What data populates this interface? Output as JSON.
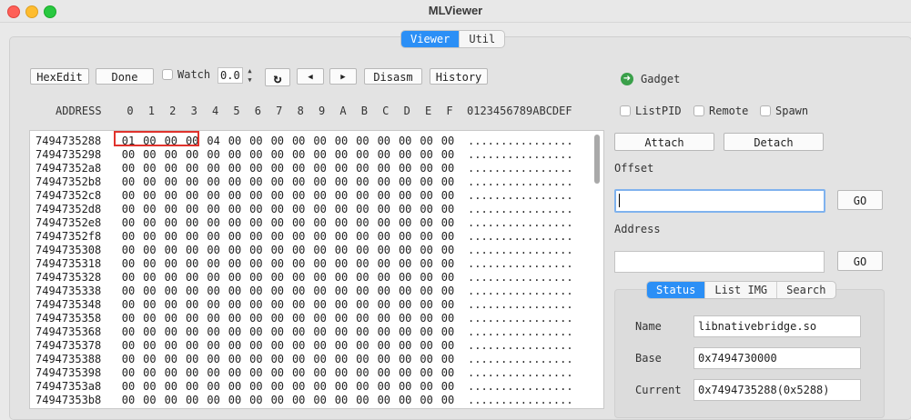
{
  "window": {
    "title": "MLViewer"
  },
  "tabs": [
    {
      "label": "Viewer",
      "selected": true
    },
    {
      "label": "Util",
      "selected": false
    }
  ],
  "toolbar": {
    "hexedit": "HexEdit",
    "done": "Done",
    "watch_label": "Watch",
    "watch_value": "0.0",
    "refresh_icon": "↻",
    "prev_icon": "◀",
    "next_icon": "▶",
    "disasm": "Disasm",
    "history": "History"
  },
  "hex": {
    "address_header": "ADDRESS",
    "columns": [
      "0",
      "1",
      "2",
      "3",
      "4",
      "5",
      "6",
      "7",
      "8",
      "9",
      "A",
      "B",
      "C",
      "D",
      "E",
      "F"
    ],
    "ascii_header": "0123456789ABCDEF",
    "rows": [
      {
        "addr": "7494735288",
        "bytes": [
          "01",
          "00",
          "00",
          "00",
          "04",
          "00",
          "00",
          "00",
          "00",
          "00",
          "00",
          "00",
          "00",
          "00",
          "00",
          "00"
        ],
        "ascii": "................"
      },
      {
        "addr": "7494735298",
        "bytes": [
          "00",
          "00",
          "00",
          "00",
          "00",
          "00",
          "00",
          "00",
          "00",
          "00",
          "00",
          "00",
          "00",
          "00",
          "00",
          "00"
        ],
        "ascii": "................"
      },
      {
        "addr": "74947352a8",
        "bytes": [
          "00",
          "00",
          "00",
          "00",
          "00",
          "00",
          "00",
          "00",
          "00",
          "00",
          "00",
          "00",
          "00",
          "00",
          "00",
          "00"
        ],
        "ascii": "................"
      },
      {
        "addr": "74947352b8",
        "bytes": [
          "00",
          "00",
          "00",
          "00",
          "00",
          "00",
          "00",
          "00",
          "00",
          "00",
          "00",
          "00",
          "00",
          "00",
          "00",
          "00"
        ],
        "ascii": "................"
      },
      {
        "addr": "74947352c8",
        "bytes": [
          "00",
          "00",
          "00",
          "00",
          "00",
          "00",
          "00",
          "00",
          "00",
          "00",
          "00",
          "00",
          "00",
          "00",
          "00",
          "00"
        ],
        "ascii": "................"
      },
      {
        "addr": "74947352d8",
        "bytes": [
          "00",
          "00",
          "00",
          "00",
          "00",
          "00",
          "00",
          "00",
          "00",
          "00",
          "00",
          "00",
          "00",
          "00",
          "00",
          "00"
        ],
        "ascii": "................"
      },
      {
        "addr": "74947352e8",
        "bytes": [
          "00",
          "00",
          "00",
          "00",
          "00",
          "00",
          "00",
          "00",
          "00",
          "00",
          "00",
          "00",
          "00",
          "00",
          "00",
          "00"
        ],
        "ascii": "................"
      },
      {
        "addr": "74947352f8",
        "bytes": [
          "00",
          "00",
          "00",
          "00",
          "00",
          "00",
          "00",
          "00",
          "00",
          "00",
          "00",
          "00",
          "00",
          "00",
          "00",
          "00"
        ],
        "ascii": "................"
      },
      {
        "addr": "7494735308",
        "bytes": [
          "00",
          "00",
          "00",
          "00",
          "00",
          "00",
          "00",
          "00",
          "00",
          "00",
          "00",
          "00",
          "00",
          "00",
          "00",
          "00"
        ],
        "ascii": "................"
      },
      {
        "addr": "7494735318",
        "bytes": [
          "00",
          "00",
          "00",
          "00",
          "00",
          "00",
          "00",
          "00",
          "00",
          "00",
          "00",
          "00",
          "00",
          "00",
          "00",
          "00"
        ],
        "ascii": "................"
      },
      {
        "addr": "7494735328",
        "bytes": [
          "00",
          "00",
          "00",
          "00",
          "00",
          "00",
          "00",
          "00",
          "00",
          "00",
          "00",
          "00",
          "00",
          "00",
          "00",
          "00"
        ],
        "ascii": "................"
      },
      {
        "addr": "7494735338",
        "bytes": [
          "00",
          "00",
          "00",
          "00",
          "00",
          "00",
          "00",
          "00",
          "00",
          "00",
          "00",
          "00",
          "00",
          "00",
          "00",
          "00"
        ],
        "ascii": "................"
      },
      {
        "addr": "7494735348",
        "bytes": [
          "00",
          "00",
          "00",
          "00",
          "00",
          "00",
          "00",
          "00",
          "00",
          "00",
          "00",
          "00",
          "00",
          "00",
          "00",
          "00"
        ],
        "ascii": "................"
      },
      {
        "addr": "7494735358",
        "bytes": [
          "00",
          "00",
          "00",
          "00",
          "00",
          "00",
          "00",
          "00",
          "00",
          "00",
          "00",
          "00",
          "00",
          "00",
          "00",
          "00"
        ],
        "ascii": "................"
      },
      {
        "addr": "7494735368",
        "bytes": [
          "00",
          "00",
          "00",
          "00",
          "00",
          "00",
          "00",
          "00",
          "00",
          "00",
          "00",
          "00",
          "00",
          "00",
          "00",
          "00"
        ],
        "ascii": "................"
      },
      {
        "addr": "7494735378",
        "bytes": [
          "00",
          "00",
          "00",
          "00",
          "00",
          "00",
          "00",
          "00",
          "00",
          "00",
          "00",
          "00",
          "00",
          "00",
          "00",
          "00"
        ],
        "ascii": "................"
      },
      {
        "addr": "7494735388",
        "bytes": [
          "00",
          "00",
          "00",
          "00",
          "00",
          "00",
          "00",
          "00",
          "00",
          "00",
          "00",
          "00",
          "00",
          "00",
          "00",
          "00"
        ],
        "ascii": "................"
      },
      {
        "addr": "7494735398",
        "bytes": [
          "00",
          "00",
          "00",
          "00",
          "00",
          "00",
          "00",
          "00",
          "00",
          "00",
          "00",
          "00",
          "00",
          "00",
          "00",
          "00"
        ],
        "ascii": "................"
      },
      {
        "addr": "74947353a8",
        "bytes": [
          "00",
          "00",
          "00",
          "00",
          "00",
          "00",
          "00",
          "00",
          "00",
          "00",
          "00",
          "00",
          "00",
          "00",
          "00",
          "00"
        ],
        "ascii": "................"
      },
      {
        "addr": "74947353b8",
        "bytes": [
          "00",
          "00",
          "00",
          "00",
          "00",
          "00",
          "00",
          "00",
          "00",
          "00",
          "00",
          "00",
          "00",
          "00",
          "00",
          "00"
        ],
        "ascii": "................"
      }
    ]
  },
  "right": {
    "gadget_label": "Gadget",
    "gadget_icon": "go-arrow-icon",
    "listpid": "ListPID",
    "remote": "Remote",
    "spawn": "Spawn",
    "attach": "Attach",
    "detach": "Detach",
    "offset_label": "Offset",
    "offset_value": "",
    "go1": "GO",
    "address_label": "Address",
    "address_value": "",
    "go2": "GO",
    "info_tabs": [
      {
        "label": "Status",
        "selected": true
      },
      {
        "label": "List IMG",
        "selected": false
      },
      {
        "label": "Search",
        "selected": false
      }
    ],
    "name_label": "Name",
    "name_value": "libnativebridge.so",
    "base_label": "Base",
    "base_value": "0x7494730000",
    "current_label": "Current",
    "current_value": "0x7494735288(0x5288)"
  },
  "colors": {
    "accent": "#2b8ff6",
    "highlight": "#e0322c",
    "gadget": "#3aa04a"
  }
}
